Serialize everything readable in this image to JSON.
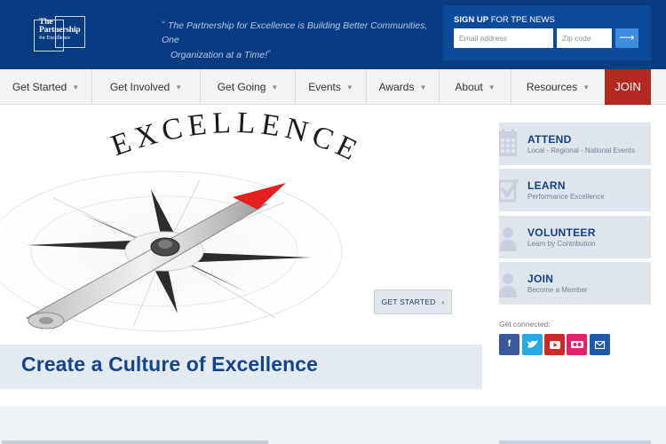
{
  "header": {
    "logo_lines": [
      "The",
      "Partnership",
      "for Excellence"
    ],
    "tagline": "The Partnership for Excellence is Building Better Communities, One Organization at a Time!",
    "tagline_line1": "The Partnership for Excellence is Building Better Communities, One",
    "tagline_line2": "Organization at a Time!",
    "signup": {
      "title_bold": "SIGN UP",
      "title_rest": " FOR TPE NEWS",
      "email_placeholder": "Email address",
      "zip_placeholder": "Zip code",
      "submit_icon": "arrow-right-icon"
    }
  },
  "nav": {
    "items": [
      {
        "label": "Get Started"
      },
      {
        "label": "Get Involved"
      },
      {
        "label": "Get Going"
      },
      {
        "label": "Events"
      },
      {
        "label": "Awards"
      },
      {
        "label": "About"
      },
      {
        "label": "Resources"
      }
    ],
    "join_label": "JOIN"
  },
  "hero": {
    "image_word": "EXCELLENCE",
    "cta_label": "GET STARTED",
    "title": "Create a Culture of Excellence"
  },
  "sidebar": {
    "cards": [
      {
        "title": "ATTEND",
        "subtitle": "Local - Regional - National Events",
        "icon": "calendar-icon"
      },
      {
        "title": "LEARN",
        "subtitle": "Performance Excellence",
        "icon": "checkbox-icon"
      },
      {
        "title": "VOLUNTEER",
        "subtitle": "Learn by Contribution",
        "icon": "person-icon"
      },
      {
        "title": "JOIN",
        "subtitle": "Become a Member",
        "icon": "person-icon"
      }
    ],
    "connected_label": "Get connected:",
    "social": [
      {
        "name": "facebook-icon",
        "glyph": "f",
        "color": "#3b5998"
      },
      {
        "name": "twitter-icon",
        "glyph": "t",
        "color": "#2aa9e0"
      },
      {
        "name": "youtube-icon",
        "glyph": "▶",
        "color": "#cc2a2a"
      },
      {
        "name": "flickr-icon",
        "glyph": "••",
        "color": "#e0216b"
      },
      {
        "name": "email-icon",
        "glyph": "✉",
        "color": "#1f5aa8"
      }
    ]
  },
  "colors": {
    "header_bg": "#073b82",
    "signup_bg": "#0d4a9a",
    "join_red": "#b22a1f",
    "brand_blue": "#15448a",
    "card_bg": "#dfe5ed"
  }
}
